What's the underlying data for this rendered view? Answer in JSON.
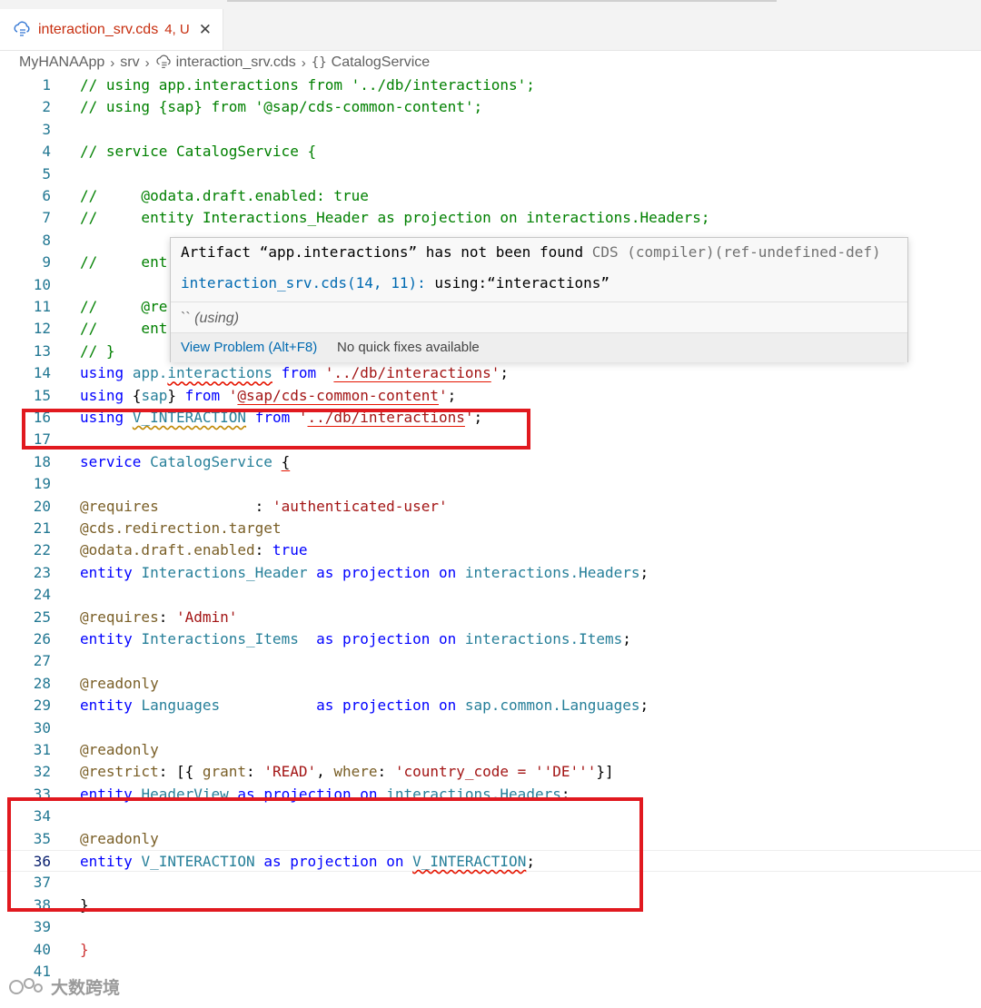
{
  "tab": {
    "filename": "interaction_srv.cds",
    "status": "4, U",
    "close_glyph": "✕",
    "icon": "cds-file-icon"
  },
  "breadcrumb": {
    "items": [
      "MyHANAApp",
      "srv",
      "interaction_srv.cds",
      "CatalogService"
    ],
    "separator": "›",
    "symbol_glyph": "{}"
  },
  "hover": {
    "message": "Artifact “app.interactions” has not been found",
    "source": "CDS (compiler)(ref-undefined-def)",
    "location_link": "interaction_srv.cds(14, 11):",
    "location_detail": "using:“interactions”",
    "code_prefix": "``",
    "code_label": "(using)",
    "view_problem": "View Problem (Alt+F8)",
    "no_fixes": "No quick fixes available"
  },
  "watermark": {
    "text": "大数跨境"
  },
  "colors": {
    "error_tab": "#c72e0f",
    "highlight_box": "#e1191f",
    "line_number": "#237893"
  },
  "editor": {
    "active_line": 36,
    "lines": [
      {
        "n": "1",
        "tokens": [
          {
            "t": "// using app.interactions from '../db/interactions';",
            "c": "c-com"
          }
        ]
      },
      {
        "n": "2",
        "tokens": [
          {
            "t": "// using {sap} from '@sap/cds-common-content';",
            "c": "c-com"
          }
        ]
      },
      {
        "n": "3",
        "tokens": []
      },
      {
        "n": "4",
        "tokens": [
          {
            "t": "// service CatalogService {",
            "c": "c-com"
          }
        ]
      },
      {
        "n": "5",
        "tokens": []
      },
      {
        "n": "6",
        "tokens": [
          {
            "t": "//     @odata.draft.enabled: true",
            "c": "c-com"
          }
        ]
      },
      {
        "n": "7",
        "tokens": [
          {
            "t": "//     entity Interactions_Header as projection on interactions.Headers;",
            "c": "c-com"
          }
        ]
      },
      {
        "n": "8",
        "tokens": []
      },
      {
        "n": "9",
        "tokens": [
          {
            "t": "//     ent",
            "c": "c-com"
          }
        ]
      },
      {
        "n": "10",
        "tokens": []
      },
      {
        "n": "11",
        "tokens": [
          {
            "t": "//     @re",
            "c": "c-com"
          }
        ]
      },
      {
        "n": "12",
        "tokens": [
          {
            "t": "//     ent",
            "c": "c-com"
          }
        ]
      },
      {
        "n": "13",
        "tokens": [
          {
            "t": "// }",
            "c": "c-com"
          }
        ]
      },
      {
        "n": "14",
        "tokens": [
          {
            "t": "using",
            "c": "c-kw"
          },
          {
            "t": " ",
            "c": "c-txt"
          },
          {
            "t": "app.",
            "c": "c-ent"
          },
          {
            "t": "interactions",
            "c": "c-ent sq-red"
          },
          {
            "t": " ",
            "c": "c-txt"
          },
          {
            "t": "from",
            "c": "c-kw"
          },
          {
            "t": " ",
            "c": "c-txt"
          },
          {
            "t": "'",
            "c": "c-str"
          },
          {
            "t": "../db/interactions",
            "c": "c-str ul-red"
          },
          {
            "t": "'",
            "c": "c-str"
          },
          {
            "t": ";",
            "c": "c-txt"
          }
        ]
      },
      {
        "n": "15",
        "tokens": [
          {
            "t": "using",
            "c": "c-kw"
          },
          {
            "t": " {",
            "c": "c-txt"
          },
          {
            "t": "sap",
            "c": "c-ent"
          },
          {
            "t": "} ",
            "c": "c-txt"
          },
          {
            "t": "from",
            "c": "c-kw"
          },
          {
            "t": " ",
            "c": "c-txt"
          },
          {
            "t": "'",
            "c": "c-str"
          },
          {
            "t": "@sap/cds-common-content",
            "c": "c-str ul-red"
          },
          {
            "t": "'",
            "c": "c-str"
          },
          {
            "t": ";",
            "c": "c-txt"
          }
        ]
      },
      {
        "n": "16",
        "tokens": [
          {
            "t": "using",
            "c": "c-kw"
          },
          {
            "t": " ",
            "c": "c-txt"
          },
          {
            "t": "V_INTERACTION",
            "c": "c-ent sq-yel"
          },
          {
            "t": " ",
            "c": "c-txt"
          },
          {
            "t": "from",
            "c": "c-kw"
          },
          {
            "t": " ",
            "c": "c-txt"
          },
          {
            "t": "'",
            "c": "c-str"
          },
          {
            "t": "../db/interactions",
            "c": "c-str ul-red"
          },
          {
            "t": "'",
            "c": "c-str"
          },
          {
            "t": ";",
            "c": "c-txt"
          }
        ]
      },
      {
        "n": "17",
        "tokens": []
      },
      {
        "n": "18",
        "tokens": [
          {
            "t": "service",
            "c": "c-kw"
          },
          {
            "t": " ",
            "c": "c-txt"
          },
          {
            "t": "CatalogService",
            "c": "c-cls"
          },
          {
            "t": " ",
            "c": "c-txt"
          },
          {
            "t": "{",
            "c": "c-txt ul-red"
          }
        ]
      },
      {
        "n": "19",
        "tokens": []
      },
      {
        "n": "20",
        "tokens": [
          {
            "t": "@requires",
            "c": "c-ann"
          },
          {
            "t": "           : ",
            "c": "c-txt"
          },
          {
            "t": "'authenticated-user'",
            "c": "c-str"
          }
        ]
      },
      {
        "n": "21",
        "tokens": [
          {
            "t": "@cds.redirection.target",
            "c": "c-ann"
          }
        ]
      },
      {
        "n": "22",
        "tokens": [
          {
            "t": "@odata.draft.enabled",
            "c": "c-ann"
          },
          {
            "t": ": ",
            "c": "c-txt"
          },
          {
            "t": "true",
            "c": "c-kw"
          }
        ]
      },
      {
        "n": "23",
        "tokens": [
          {
            "t": "entity",
            "c": "c-kw"
          },
          {
            "t": " ",
            "c": "c-txt"
          },
          {
            "t": "Interactions_Header",
            "c": "c-ent"
          },
          {
            "t": " ",
            "c": "c-txt"
          },
          {
            "t": "as",
            "c": "c-kw"
          },
          {
            "t": " ",
            "c": "c-txt"
          },
          {
            "t": "projection",
            "c": "c-kw"
          },
          {
            "t": " ",
            "c": "c-txt"
          },
          {
            "t": "on",
            "c": "c-kw"
          },
          {
            "t": " ",
            "c": "c-txt"
          },
          {
            "t": "interactions.Headers",
            "c": "c-ent"
          },
          {
            "t": ";",
            "c": "c-txt"
          }
        ]
      },
      {
        "n": "24",
        "tokens": []
      },
      {
        "n": "25",
        "tokens": [
          {
            "t": "@requires",
            "c": "c-ann"
          },
          {
            "t": ": ",
            "c": "c-txt"
          },
          {
            "t": "'Admin'",
            "c": "c-str"
          }
        ]
      },
      {
        "n": "26",
        "tokens": [
          {
            "t": "entity",
            "c": "c-kw"
          },
          {
            "t": " ",
            "c": "c-txt"
          },
          {
            "t": "Interactions_Items",
            "c": "c-ent"
          },
          {
            "t": "  ",
            "c": "c-txt"
          },
          {
            "t": "as",
            "c": "c-kw"
          },
          {
            "t": " ",
            "c": "c-txt"
          },
          {
            "t": "projection",
            "c": "c-kw"
          },
          {
            "t": " ",
            "c": "c-txt"
          },
          {
            "t": "on",
            "c": "c-kw"
          },
          {
            "t": " ",
            "c": "c-txt"
          },
          {
            "t": "interactions.Items",
            "c": "c-ent"
          },
          {
            "t": ";",
            "c": "c-txt"
          }
        ]
      },
      {
        "n": "27",
        "tokens": []
      },
      {
        "n": "28",
        "tokens": [
          {
            "t": "@readonly",
            "c": "c-ann"
          }
        ]
      },
      {
        "n": "29",
        "tokens": [
          {
            "t": "entity",
            "c": "c-kw"
          },
          {
            "t": " ",
            "c": "c-txt"
          },
          {
            "t": "Languages",
            "c": "c-ent"
          },
          {
            "t": "           ",
            "c": "c-txt"
          },
          {
            "t": "as",
            "c": "c-kw"
          },
          {
            "t": " ",
            "c": "c-txt"
          },
          {
            "t": "projection",
            "c": "c-kw"
          },
          {
            "t": " ",
            "c": "c-txt"
          },
          {
            "t": "on",
            "c": "c-kw"
          },
          {
            "t": " ",
            "c": "c-txt"
          },
          {
            "t": "sap.common.Languages",
            "c": "c-ent"
          },
          {
            "t": ";",
            "c": "c-txt"
          }
        ]
      },
      {
        "n": "30",
        "tokens": []
      },
      {
        "n": "31",
        "tokens": [
          {
            "t": "@readonly",
            "c": "c-ann"
          }
        ]
      },
      {
        "n": "32",
        "tokens": [
          {
            "t": "@restrict",
            "c": "c-ann"
          },
          {
            "t": ": [{ ",
            "c": "c-txt"
          },
          {
            "t": "grant",
            "c": "c-ann"
          },
          {
            "t": ": ",
            "c": "c-txt"
          },
          {
            "t": "'READ'",
            "c": "c-str"
          },
          {
            "t": ", ",
            "c": "c-txt"
          },
          {
            "t": "where",
            "c": "c-ann"
          },
          {
            "t": ": ",
            "c": "c-txt"
          },
          {
            "t": "'country_code = ''DE'''",
            "c": "c-str"
          },
          {
            "t": "}]",
            "c": "c-txt"
          }
        ]
      },
      {
        "n": "33",
        "tokens": [
          {
            "t": "entity",
            "c": "c-kw"
          },
          {
            "t": " ",
            "c": "c-txt"
          },
          {
            "t": "HeaderView",
            "c": "c-ent"
          },
          {
            "t": " ",
            "c": "c-txt"
          },
          {
            "t": "as",
            "c": "c-kw"
          },
          {
            "t": " ",
            "c": "c-txt"
          },
          {
            "t": "projection",
            "c": "c-kw"
          },
          {
            "t": " ",
            "c": "c-txt"
          },
          {
            "t": "on",
            "c": "c-kw"
          },
          {
            "t": " ",
            "c": "c-txt"
          },
          {
            "t": "interactions.Headers",
            "c": "c-ent"
          },
          {
            "t": ";",
            "c": "c-txt"
          }
        ]
      },
      {
        "n": "34",
        "tokens": []
      },
      {
        "n": "35",
        "tokens": [
          {
            "t": "@readonly",
            "c": "c-ann"
          }
        ]
      },
      {
        "n": "36",
        "tokens": [
          {
            "t": "entity",
            "c": "c-kw"
          },
          {
            "t": " ",
            "c": "c-txt"
          },
          {
            "t": "V_INTERACTION",
            "c": "c-ent"
          },
          {
            "t": " ",
            "c": "c-txt"
          },
          {
            "t": "as",
            "c": "c-kw"
          },
          {
            "t": " ",
            "c": "c-txt"
          },
          {
            "t": "projection",
            "c": "c-kw"
          },
          {
            "t": " ",
            "c": "c-txt"
          },
          {
            "t": "on",
            "c": "c-kw"
          },
          {
            "t": " ",
            "c": "c-txt"
          },
          {
            "t": "V_INTERACTION",
            "c": "c-ent sq-red"
          },
          {
            "t": ";",
            "c": "c-txt"
          }
        ]
      },
      {
        "n": "37",
        "tokens": []
      },
      {
        "n": "38",
        "tokens": [
          {
            "t": "}",
            "c": "c-txt"
          }
        ]
      },
      {
        "n": "39",
        "tokens": []
      },
      {
        "n": "40",
        "tokens": [
          {
            "t": "}",
            "c": "c-red"
          }
        ]
      },
      {
        "n": "41",
        "tokens": []
      }
    ]
  }
}
